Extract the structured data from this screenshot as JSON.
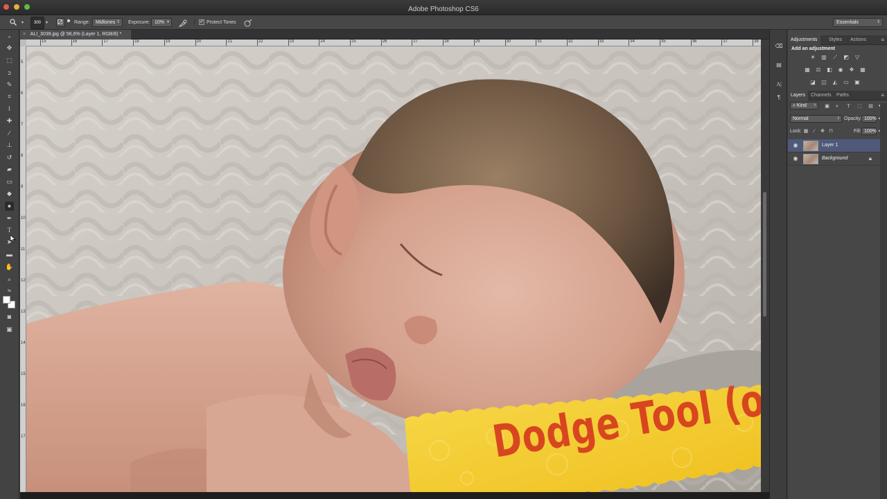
{
  "window": {
    "title": "Adobe Photoshop CS6"
  },
  "options_bar": {
    "brush_size": "300",
    "range_label": "Range:",
    "range_value": "Midtones",
    "exposure_label": "Exposure:",
    "exposure_value": "10%",
    "protect_tones_label": "Protect Tones",
    "protect_tones_checked": true,
    "workspace": "Essentials"
  },
  "document": {
    "tab_title": "ALI_3039.jpg @ 56,6% (Layer 1, RGB/8) *",
    "ruler_h_ticks": [
      "15",
      "16",
      "17",
      "18",
      "19",
      "20",
      "21",
      "22",
      "23",
      "24",
      "25",
      "26",
      "27",
      "28",
      "29",
      "30",
      "31",
      "32",
      "33",
      "34",
      "35",
      "36",
      "37",
      "38"
    ],
    "ruler_v_ticks": [
      "5",
      "6",
      "7",
      "8",
      "9",
      "10",
      "11",
      "12",
      "13",
      "14",
      "15",
      "16",
      "17"
    ]
  },
  "overlay": {
    "banner_text": "Dodge Tool (o)"
  },
  "panels": {
    "top_tabs": [
      "Adjustments",
      "Styles",
      "Actions"
    ],
    "adjustments_title": "Add an adjustment",
    "layer_tabs": [
      "Layers",
      "Channels",
      "Paths"
    ],
    "kind_label": "Kind",
    "blend_mode": "Normal",
    "opacity_label": "Opacity:",
    "opacity_value": "100%",
    "lock_label": "Lock:",
    "fill_label": "Fill:",
    "fill_value": "100%",
    "layers": [
      {
        "name": "Layer 1",
        "selected": true,
        "locked": false
      },
      {
        "name": "Background",
        "selected": false,
        "locked": true
      }
    ]
  },
  "colors": {
    "banner_yellow": "#f4cc2a",
    "banner_text": "#d8461f",
    "selected_layer": "#4f5a7a"
  }
}
